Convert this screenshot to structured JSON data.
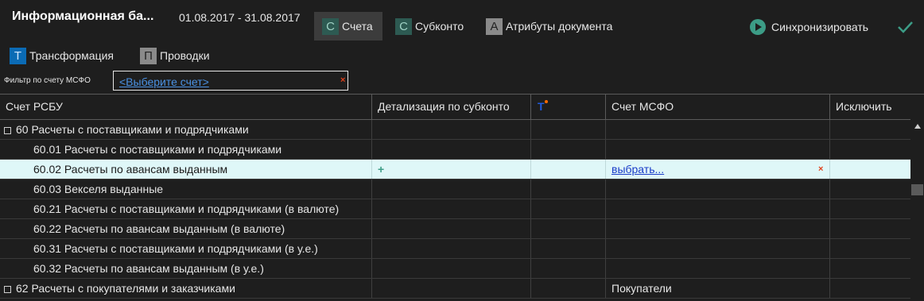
{
  "header": {
    "title": "Информационная ба...",
    "period": "01.08.2017 - 31.08.2017",
    "tabs": [
      {
        "letter": "С",
        "label": "Счета"
      },
      {
        "letter": "С",
        "label": "Субконто"
      },
      {
        "letter": "А",
        "label": "Атрибуты документа"
      }
    ],
    "sync_label": "Синхронизировать",
    "tabs2": [
      {
        "letter": "Т",
        "label": "Трансформация"
      },
      {
        "letter": "П",
        "label": "Проводки"
      }
    ]
  },
  "filter": {
    "label": "Фильтр по счету МСФО",
    "link": "<Выберите счет>",
    "clear": "×"
  },
  "table": {
    "columns": [
      "Счет РСБУ",
      "Детализация по субконто",
      "",
      "Счет МСФО",
      "Исключить"
    ],
    "rows": [
      {
        "account": "60 Расчеты с поставщиками и подрядчиками",
        "detail": "",
        "msfo": "",
        "group": true
      },
      {
        "account": "60.01 Расчеты с поставщиками и подрядчиками",
        "detail": "",
        "msfo": ""
      },
      {
        "account": "60.02 Расчеты по авансам выданным",
        "detail": "+",
        "msfo": "выбрать...",
        "clear": "×",
        "selected": true
      },
      {
        "account": "60.03 Векселя выданные",
        "detail": "",
        "msfo": ""
      },
      {
        "account": "60.21 Расчеты с поставщиками и подрядчиками (в валюте)",
        "detail": "",
        "msfo": ""
      },
      {
        "account": "60.22 Расчеты по авансам выданным (в валюте)",
        "detail": "",
        "msfo": ""
      },
      {
        "account": "60.31 Расчеты с поставщиками и подрядчиками (в у.е.)",
        "detail": "",
        "msfo": ""
      },
      {
        "account": "60.32 Расчеты по авансам выданным (в у.е.)",
        "detail": "",
        "msfo": ""
      },
      {
        "account": "62 Расчеты с покупателями и заказчиками",
        "detail": "",
        "msfo": "Покупатели",
        "group": true
      }
    ]
  },
  "colors": {
    "accent": "#3c9c86",
    "selected_row": "#dff7f8",
    "link": "#4a90e2",
    "clear": "#e0401a"
  }
}
